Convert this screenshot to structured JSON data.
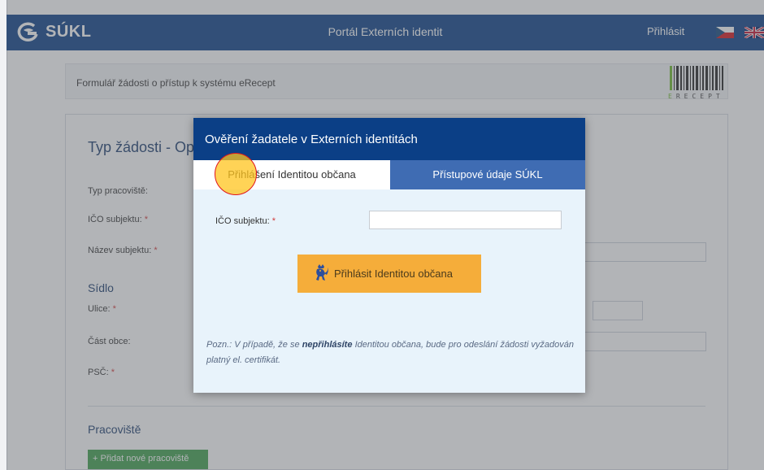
{
  "header": {
    "logo_text": "SÚKL",
    "title": "Portál Externích identit",
    "login_label": "Přihlásit"
  },
  "subheader": {
    "text": "Formulář žádosti o přístup k systému eRecept",
    "logo_text_first": "E",
    "logo_text_rest": "RECEPT"
  },
  "form": {
    "title": "Typ žádosti - Opt",
    "fields": {
      "workplace_type": "Typ pracoviště:",
      "ico": "IČO subjektu:",
      "name": "Název subjektu:",
      "street": "Ulice:",
      "district": "Část obce:",
      "zip": "PSČ:"
    },
    "required_mark": "*",
    "section_seat": "Sídlo",
    "section_workplace": "Pracoviště",
    "add_button": "+ Přidat nové pracoviště"
  },
  "modal": {
    "title": "Ověření žadatele v Externích identitách",
    "tabs": [
      {
        "label": "Přihlášení Identitou občana",
        "active": true
      },
      {
        "label": "Přístupové údaje SÚKL",
        "active": false
      }
    ],
    "ico_label": "IČO subjektu:",
    "ico_value": "",
    "required_mark": "*",
    "login_button": "Přihlásit Identitou občana",
    "note_prefix": "Pozn.: V případě, že se ",
    "note_bold": "nepřihlásíte",
    "note_suffix": " Identitou občana, bude pro odeslání žádosti vyžadován platný el. certifikát."
  },
  "colors": {
    "header_blue": "#0b3f86",
    "tab_blue": "#3f6cb3",
    "button_orange": "#f5ad3a",
    "add_green": "#3ea04b"
  }
}
